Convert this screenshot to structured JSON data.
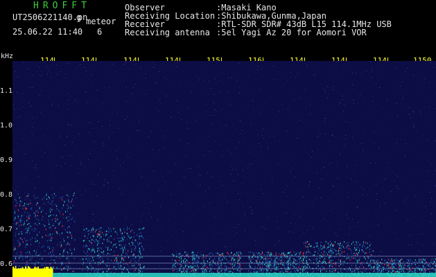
{
  "app": {
    "title": "HROFFT"
  },
  "file": {
    "name": "UT2506221140.pn",
    "ext_fragment": "g",
    "mode": "meteor",
    "datetime": "25.06.22 11:40",
    "count": "6"
  },
  "station_info": [
    {
      "label": "Observer",
      "value": ":Masaki Kano"
    },
    {
      "label": "Receiving Location",
      "value": ":Shibukawa,Gunma,Japan"
    },
    {
      "label": "Receiver",
      "value": ":RTL-SDR SDR# 43dB L15 114.1MHz USB"
    },
    {
      "label": "Receiving antenna",
      "value": ":5el Yagi Az 20 for Aomori VOR"
    }
  ],
  "axis": {
    "unit": "kHz",
    "frequency_labels": [
      "114",
      "114",
      "114",
      "114",
      "115",
      "116",
      "114",
      "114",
      "114",
      "1150"
    ],
    "y_labels": [
      "1.1",
      "1.0",
      "0.9",
      "0.8",
      "0.7",
      "0.6"
    ]
  },
  "colors": {
    "background": "#0d0d45",
    "axis_text": "#ffff33",
    "title": "#3fcf3f",
    "signal_low": "#1f5aa8",
    "signal_mid": "#2bd9c8",
    "signal_high": "#ff3b3b",
    "carrier": "#ffff00"
  }
}
